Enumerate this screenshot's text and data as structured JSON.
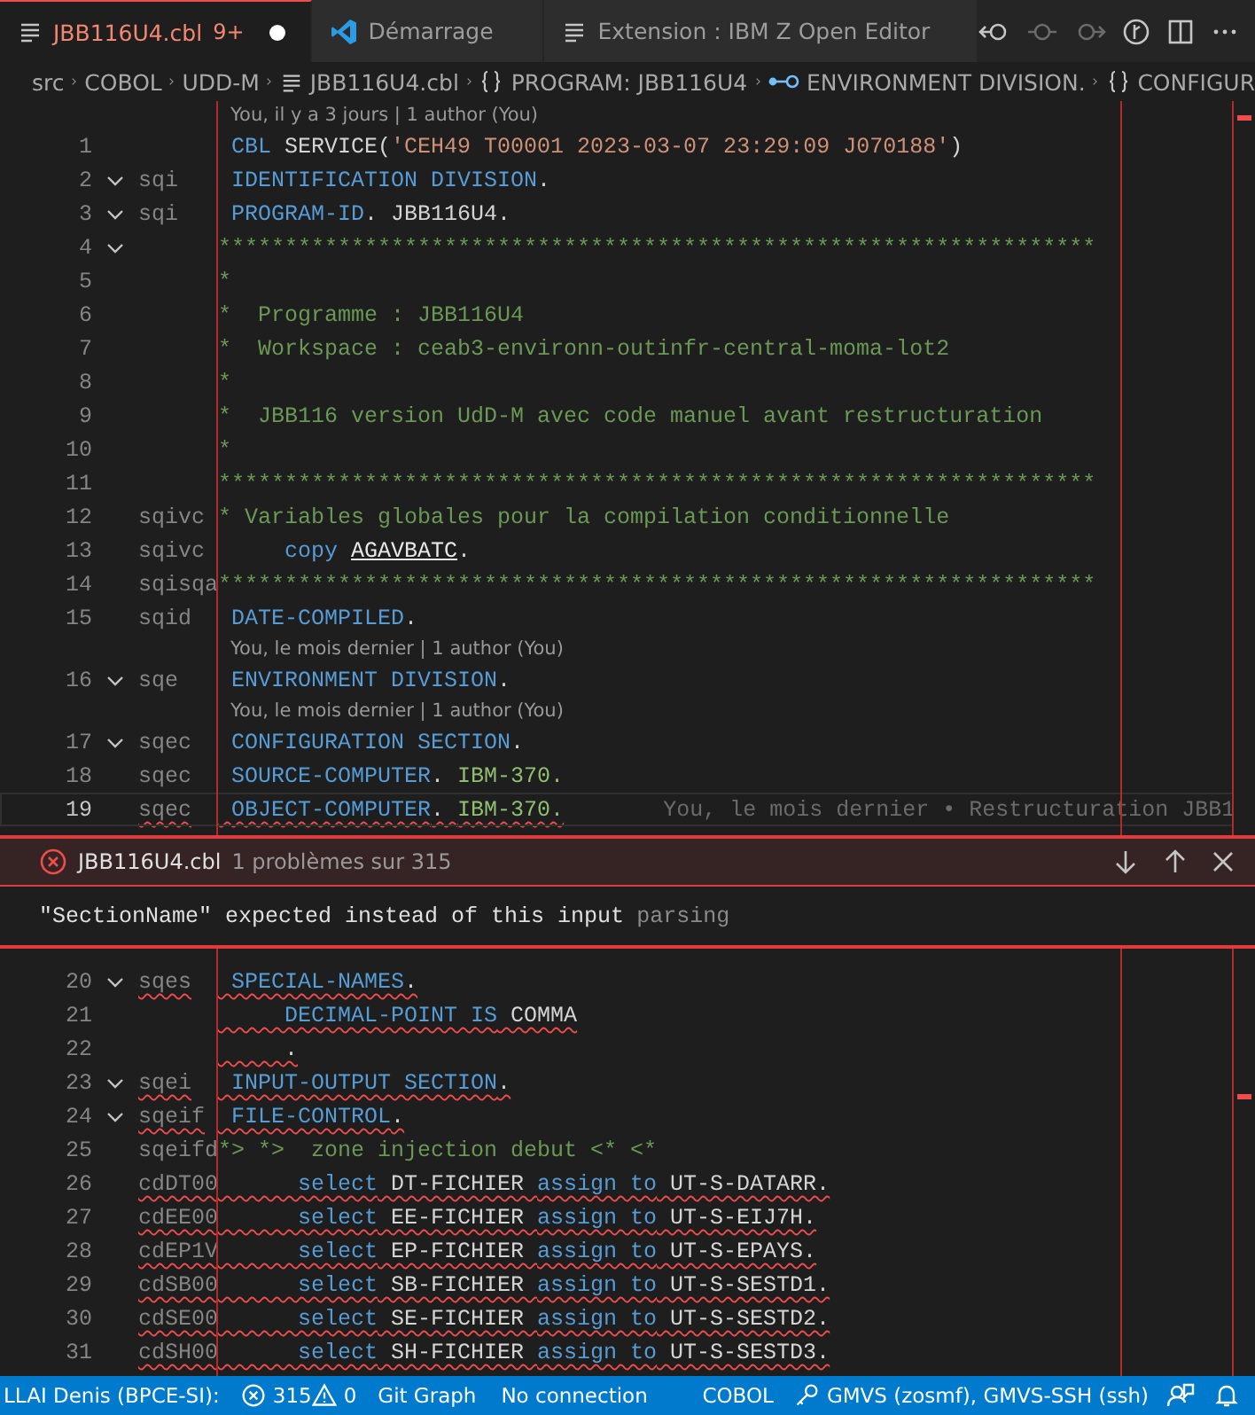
{
  "tabs": [
    {
      "label": "JBB116U4.cbl",
      "kind": "file",
      "selected": true,
      "has_errors": true,
      "badge": "9+",
      "modified": true
    },
    {
      "label": "Démarrage",
      "kind": "welcome",
      "selected": false,
      "has_errors": false,
      "modified": false
    },
    {
      "label": "Extension : IBM Z Open Editor",
      "kind": "file",
      "selected": false,
      "has_errors": false,
      "modified": false
    }
  ],
  "breadcrumbs": [
    {
      "label": "src",
      "kind": "folder"
    },
    {
      "label": "COBOL",
      "kind": "folder"
    },
    {
      "label": "UDD-M",
      "kind": "folder"
    },
    {
      "label": "JBB116U4.cbl",
      "kind": "file"
    },
    {
      "label": "PROGRAM: JBB116U4",
      "kind": "braces"
    },
    {
      "label": "ENVIRONMENT DIVISION.",
      "kind": "field"
    },
    {
      "label": "CONFIGUR",
      "kind": "braces"
    }
  ],
  "editor_top": [
    {
      "kind": "lens",
      "text": "You, il y a 3 jours | 1 author (You)"
    },
    {
      "kind": "code",
      "number": "1",
      "fold": false,
      "error": false,
      "current": false,
      "tokens": [
        {
          "text": " CBL",
          "kind": "keyword"
        },
        {
          "text": " SERVICE(",
          "kind": "plain"
        },
        {
          "text": "'CEH49 T00001 2023-03-07 23:29:09 J070188'",
          "kind": "string"
        },
        {
          "text": ")",
          "kind": "plain"
        }
      ]
    },
    {
      "kind": "code",
      "number": "2",
      "seq": "sqi",
      "fold": true,
      "error": false,
      "current": false,
      "tokens": [
        {
          "text": " IDENTIFICATION DIVISION",
          "kind": "keyword"
        },
        {
          "text": ".",
          "kind": "plain"
        }
      ]
    },
    {
      "kind": "code",
      "number": "3",
      "seq": "sqi",
      "fold": true,
      "error": false,
      "current": false,
      "tokens": [
        {
          "text": " PROGRAM-ID",
          "kind": "keyword"
        },
        {
          "text": ". JBB116U4.",
          "kind": "plain"
        }
      ]
    },
    {
      "kind": "code",
      "number": "4",
      "fold": true,
      "error": false,
      "current": false,
      "tokens": [
        {
          "text": "******************************************************************",
          "kind": "comment"
        }
      ]
    },
    {
      "kind": "code",
      "number": "5",
      "fold": false,
      "error": false,
      "current": false,
      "tokens": [
        {
          "text": "*",
          "kind": "comment"
        }
      ]
    },
    {
      "kind": "code",
      "number": "6",
      "fold": false,
      "error": false,
      "current": false,
      "tokens": [
        {
          "text": "*  Programme : JBB116U4",
          "kind": "comment"
        }
      ]
    },
    {
      "kind": "code",
      "number": "7",
      "fold": false,
      "error": false,
      "current": false,
      "tokens": [
        {
          "text": "*  Workspace : ceab3-environn-outinfr-central-moma-lot2",
          "kind": "comment"
        }
      ]
    },
    {
      "kind": "code",
      "number": "8",
      "fold": false,
      "error": false,
      "current": false,
      "tokens": [
        {
          "text": "*",
          "kind": "comment"
        }
      ]
    },
    {
      "kind": "code",
      "number": "9",
      "fold": false,
      "error": false,
      "current": false,
      "tokens": [
        {
          "text": "*  JBB116 version UdD-M avec code manuel avant restructuration",
          "kind": "comment"
        }
      ]
    },
    {
      "kind": "code",
      "number": "10",
      "fold": false,
      "error": false,
      "current": false,
      "tokens": [
        {
          "text": "*",
          "kind": "comment"
        }
      ]
    },
    {
      "kind": "code",
      "number": "11",
      "fold": false,
      "error": false,
      "current": false,
      "tokens": [
        {
          "text": "******************************************************************",
          "kind": "comment"
        }
      ]
    },
    {
      "kind": "code",
      "number": "12",
      "seq": "sqivc",
      "fold": false,
      "error": false,
      "current": false,
      "tokens": [
        {
          "text": "* Variables globales pour la compilation conditionnelle",
          "kind": "comment"
        }
      ]
    },
    {
      "kind": "code",
      "number": "13",
      "seq": "sqivc",
      "fold": false,
      "error": false,
      "current": false,
      "tokens": [
        {
          "text": "     copy ",
          "kind": "keyword"
        },
        {
          "text": "AGAVBATC",
          "kind": "link"
        },
        {
          "text": ".",
          "kind": "plain"
        }
      ]
    },
    {
      "kind": "code",
      "number": "14",
      "seq": "sqisqa",
      "fold": false,
      "error": false,
      "current": false,
      "tokens": [
        {
          "text": "******************************************************************",
          "kind": "comment"
        }
      ]
    },
    {
      "kind": "code",
      "number": "15",
      "seq": "sqid",
      "fold": false,
      "error": false,
      "current": false,
      "tokens": [
        {
          "text": " DATE-COMPILED",
          "kind": "keyword"
        },
        {
          "text": ".",
          "kind": "plain"
        }
      ]
    },
    {
      "kind": "lens",
      "text": "You, le mois dernier | 1 author (You)"
    },
    {
      "kind": "code",
      "number": "16",
      "seq": "sqe",
      "fold": true,
      "error": false,
      "current": false,
      "tokens": [
        {
          "text": " ENVIRONMENT DIVISION",
          "kind": "keyword"
        },
        {
          "text": ".",
          "kind": "plain"
        }
      ]
    },
    {
      "kind": "lens",
      "text": "You, le mois dernier | 1 author (You)"
    },
    {
      "kind": "code",
      "number": "17",
      "seq": "sqec",
      "fold": true,
      "error": false,
      "current": false,
      "tokens": [
        {
          "text": " CONFIGURATION SECTION",
          "kind": "keyword"
        },
        {
          "text": ".",
          "kind": "plain"
        }
      ]
    },
    {
      "kind": "code",
      "number": "18",
      "seq": "sqec",
      "fold": false,
      "error": false,
      "current": false,
      "tokens": [
        {
          "text": " SOURCE-COMPUTER",
          "kind": "keyword"
        },
        {
          "text": ". ",
          "kind": "plain"
        },
        {
          "text": "IBM-370.",
          "kind": "literal"
        }
      ]
    },
    {
      "kind": "code",
      "number": "19",
      "seq": "sqec",
      "fold": false,
      "error": true,
      "current": true,
      "blame": "You, le mois dernier • Restructuration JBB1",
      "tokens": [
        {
          "text": " OBJECT-COMPUTER",
          "kind": "keyword"
        },
        {
          "text": ". ",
          "kind": "plain"
        },
        {
          "text": "IBM-370.",
          "kind": "literal"
        }
      ]
    }
  ],
  "problem_peek": {
    "file": "JBB116U4.cbl",
    "count": "1 problèmes sur 315",
    "message": "\"SectionName\" expected instead of this input",
    "source": "parsing"
  },
  "editor_bottom": [
    {
      "kind": "code",
      "number": "20",
      "seq": "sqes",
      "fold": true,
      "error": true,
      "current": false,
      "tokens": [
        {
          "text": " SPECIAL-NAMES",
          "kind": "keyword"
        },
        {
          "text": ".",
          "kind": "plain"
        }
      ]
    },
    {
      "kind": "code",
      "number": "21",
      "fold": false,
      "error": true,
      "current": false,
      "tokens": [
        {
          "text": "     DECIMAL-POINT IS",
          "kind": "keyword"
        },
        {
          "text": " COMMA",
          "kind": "plain"
        }
      ]
    },
    {
      "kind": "code",
      "number": "22",
      "fold": false,
      "error": true,
      "current": false,
      "tokens": [
        {
          "text": "     .",
          "kind": "plain"
        }
      ]
    },
    {
      "kind": "code",
      "number": "23",
      "seq": "sqei",
      "fold": true,
      "error": true,
      "current": false,
      "tokens": [
        {
          "text": " INPUT-OUTPUT SECTION",
          "kind": "keyword"
        },
        {
          "text": ".",
          "kind": "plain"
        }
      ]
    },
    {
      "kind": "code",
      "number": "24",
      "seq": "sqeif",
      "fold": true,
      "error": true,
      "current": false,
      "tokens": [
        {
          "text": " FILE-CONTROL",
          "kind": "keyword"
        },
        {
          "text": ".",
          "kind": "plain"
        }
      ]
    },
    {
      "kind": "code",
      "number": "25",
      "seq": "sqeifd",
      "fold": false,
      "error": false,
      "current": false,
      "tokens": [
        {
          "text": "*> *>  zone injection debut <* <*",
          "kind": "comment"
        }
      ]
    },
    {
      "kind": "code",
      "number": "26",
      "seq": "cdDT00",
      "fold": false,
      "error": true,
      "current": false,
      "tokens": [
        {
          "text": "      select",
          "kind": "keyword"
        },
        {
          "text": " DT-FICHIER ",
          "kind": "plain"
        },
        {
          "text": "assign to",
          "kind": "keyword"
        },
        {
          "text": " UT-S-DATARR.",
          "kind": "plain"
        }
      ]
    },
    {
      "kind": "code",
      "number": "27",
      "seq": "cdEE00",
      "fold": false,
      "error": true,
      "current": false,
      "tokens": [
        {
          "text": "      select",
          "kind": "keyword"
        },
        {
          "text": " EE-FICHIER ",
          "kind": "plain"
        },
        {
          "text": "assign to",
          "kind": "keyword"
        },
        {
          "text": " UT-S-EIJ7H.",
          "kind": "plain"
        }
      ]
    },
    {
      "kind": "code",
      "number": "28",
      "seq": "cdEP1V",
      "fold": false,
      "error": true,
      "current": false,
      "tokens": [
        {
          "text": "      select",
          "kind": "keyword"
        },
        {
          "text": " EP-FICHIER ",
          "kind": "plain"
        },
        {
          "text": "assign to",
          "kind": "keyword"
        },
        {
          "text": " UT-S-EPAYS.",
          "kind": "plain"
        }
      ]
    },
    {
      "kind": "code",
      "number": "29",
      "seq": "cdSB00",
      "fold": false,
      "error": true,
      "current": false,
      "tokens": [
        {
          "text": "      select",
          "kind": "keyword"
        },
        {
          "text": " SB-FICHIER ",
          "kind": "plain"
        },
        {
          "text": "assign to",
          "kind": "keyword"
        },
        {
          "text": " UT-S-SESTD1.",
          "kind": "plain"
        }
      ]
    },
    {
      "kind": "code",
      "number": "30",
      "seq": "cdSE00",
      "fold": false,
      "error": true,
      "current": false,
      "tokens": [
        {
          "text": "      select",
          "kind": "keyword"
        },
        {
          "text": " SE-FICHIER ",
          "kind": "plain"
        },
        {
          "text": "assign to",
          "kind": "keyword"
        },
        {
          "text": " UT-S-SESTD2.",
          "kind": "plain"
        }
      ]
    },
    {
      "kind": "code",
      "number": "31",
      "seq": "cdSH00",
      "fold": false,
      "error": true,
      "current": false,
      "tokens": [
        {
          "text": "      select",
          "kind": "keyword"
        },
        {
          "text": " SH-FICHIER ",
          "kind": "plain"
        },
        {
          "text": "assign to",
          "kind": "keyword"
        },
        {
          "text": " UT-S-SESTD3.",
          "kind": "plain"
        }
      ]
    }
  ],
  "status_bar": {
    "left": [
      {
        "kind": "text",
        "text": "LLAI Denis (BPCE-SI):"
      },
      {
        "kind": "errors",
        "text": "315"
      },
      {
        "kind": "warnings",
        "text": "0"
      },
      {
        "kind": "text",
        "text": "Git Graph"
      },
      {
        "kind": "text",
        "text": "No connection"
      }
    ],
    "right": [
      {
        "kind": "text",
        "text": "COBOL"
      },
      {
        "kind": "remote",
        "text": "GMVS (zosmf), GMVS-SSH (ssh)"
      }
    ]
  }
}
